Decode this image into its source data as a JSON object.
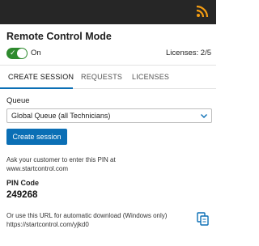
{
  "header": {
    "brand_icon": "wifi-signal-icon",
    "bar_color": "#262626",
    "accent": "#f39c12"
  },
  "panel": {
    "title": "Remote Control Mode",
    "toggle": {
      "state": true,
      "label": "On",
      "color": "#2e8a2e"
    },
    "licenses": "Licenses: 2/5"
  },
  "tabs": [
    {
      "label": "CREATE SESSION",
      "active": true
    },
    {
      "label": "REQUESTS",
      "active": false
    },
    {
      "label": "LICENSES",
      "active": false
    }
  ],
  "form": {
    "queue_label": "Queue",
    "queue_value": "Global Queue (all Technicians)",
    "create_button": "Create session",
    "button_color": "#0b6fb5"
  },
  "instructions": {
    "pin_hint": "Ask your customer to enter this PIN at www.startcontrol.com",
    "pin_label": "PIN Code",
    "pin_value": "249268",
    "url_hint": "Or use this URL for automatic download (Windows only) https://startcontrol.com/yjkd0",
    "copy_icon": "copy-icon"
  }
}
